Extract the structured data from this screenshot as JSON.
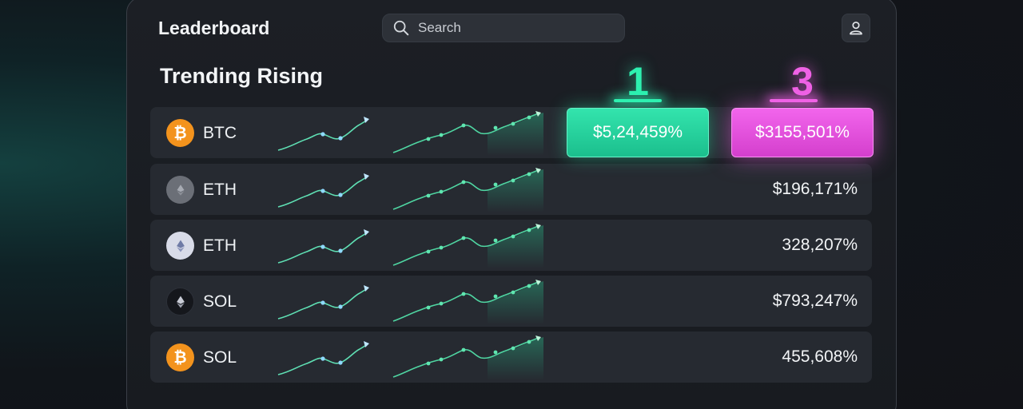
{
  "header": {
    "title": "Leaderboard",
    "search_placeholder": "Search",
    "avatar_icon": "user-icon"
  },
  "section": {
    "title": "Trending Rising"
  },
  "ranks": {
    "first": "1",
    "third": "3"
  },
  "highlights": {
    "green_value": "$5,24,459%",
    "pink_value": "$3155,501%"
  },
  "colors": {
    "accent_green": "#2ef0b0",
    "accent_pink": "#f062e6",
    "btc_orange": "#f3931d"
  },
  "rows": [
    {
      "coin": "BTC",
      "icon": "bitcoin-icon",
      "value": ""
    },
    {
      "coin": "ETH",
      "icon": "ethereum-icon",
      "value": "$196,171%"
    },
    {
      "coin": "ETH",
      "icon": "ethereum-icon",
      "value": "328,207%"
    },
    {
      "coin": "SOL",
      "icon": "ethereum-icon",
      "value": "$793,247%"
    },
    {
      "coin": "SOL",
      "icon": "bitcoin-icon",
      "value": "455,608%"
    }
  ]
}
